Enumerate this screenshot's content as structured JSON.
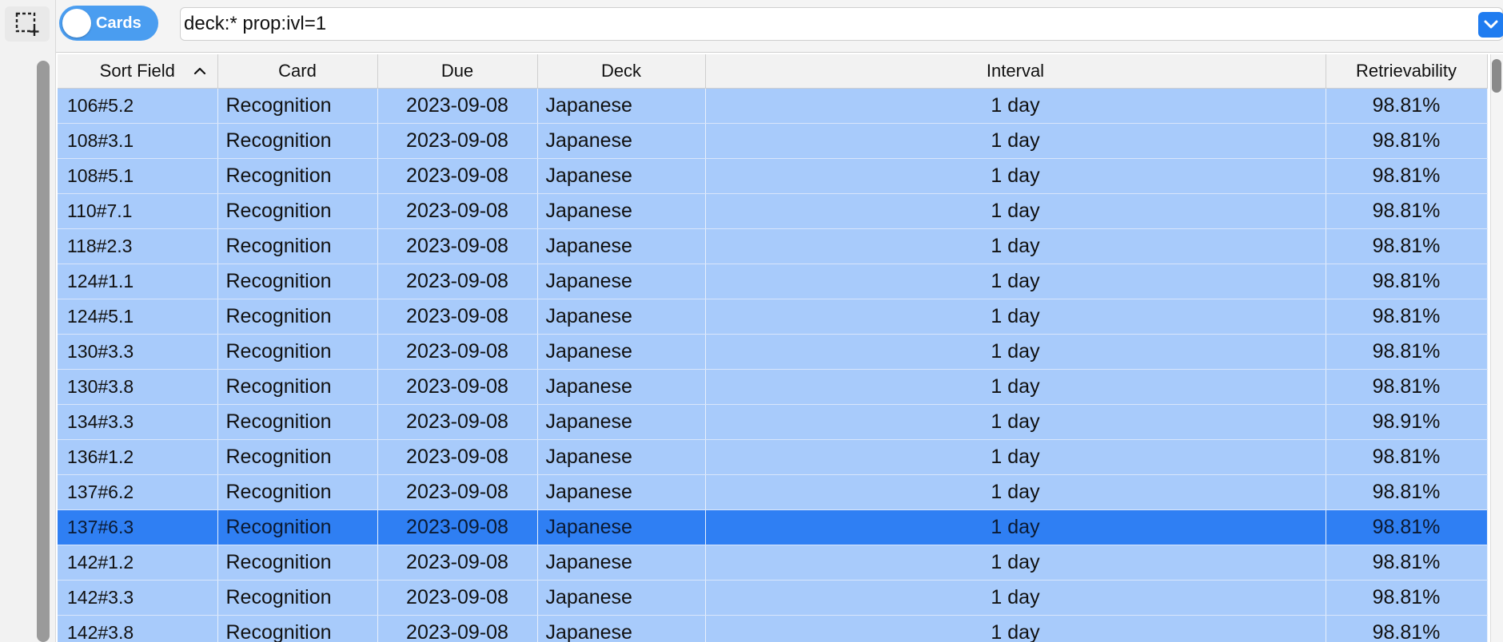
{
  "toggle": {
    "label": "Cards",
    "accent": "#4a9df0"
  },
  "search": {
    "value": "deck:* prop:ivl=1"
  },
  "icons": {
    "select": "select-marquee-plus-icon",
    "dropdown": "chevron-down-icon",
    "sort": "chevron-up-icon"
  },
  "table": {
    "headers": {
      "sort_field": "Sort Field",
      "card": "Card",
      "due": "Due",
      "deck": "Deck",
      "interval": "Interval",
      "retrievability": "Retrievability"
    },
    "rows": [
      {
        "sort": "106#5.2",
        "card": "Recognition",
        "due": "2023-09-08",
        "deck": "Japanese",
        "interval": "1 day",
        "ret": "98.81%"
      },
      {
        "sort": "108#3.1",
        "card": "Recognition",
        "due": "2023-09-08",
        "deck": "Japanese",
        "interval": "1 day",
        "ret": "98.81%"
      },
      {
        "sort": "108#5.1",
        "card": "Recognition",
        "due": "2023-09-08",
        "deck": "Japanese",
        "interval": "1 day",
        "ret": "98.81%"
      },
      {
        "sort": "110#7.1",
        "card": "Recognition",
        "due": "2023-09-08",
        "deck": "Japanese",
        "interval": "1 day",
        "ret": "98.81%"
      },
      {
        "sort": "118#2.3",
        "card": "Recognition",
        "due": "2023-09-08",
        "deck": "Japanese",
        "interval": "1 day",
        "ret": "98.81%"
      },
      {
        "sort": "124#1.1",
        "card": "Recognition",
        "due": "2023-09-08",
        "deck": "Japanese",
        "interval": "1 day",
        "ret": "98.81%"
      },
      {
        "sort": "124#5.1",
        "card": "Recognition",
        "due": "2023-09-08",
        "deck": "Japanese",
        "interval": "1 day",
        "ret": "98.81%"
      },
      {
        "sort": "130#3.3",
        "card": "Recognition",
        "due": "2023-09-08",
        "deck": "Japanese",
        "interval": "1 day",
        "ret": "98.81%"
      },
      {
        "sort": "130#3.8",
        "card": "Recognition",
        "due": "2023-09-08",
        "deck": "Japanese",
        "interval": "1 day",
        "ret": "98.81%"
      },
      {
        "sort": "134#3.3",
        "card": "Recognition",
        "due": "2023-09-08",
        "deck": "Japanese",
        "interval": "1 day",
        "ret": "98.91%"
      },
      {
        "sort": "136#1.2",
        "card": "Recognition",
        "due": "2023-09-08",
        "deck": "Japanese",
        "interval": "1 day",
        "ret": "98.81%"
      },
      {
        "sort": "137#6.2",
        "card": "Recognition",
        "due": "2023-09-08",
        "deck": "Japanese",
        "interval": "1 day",
        "ret": "98.81%"
      },
      {
        "sort": "137#6.3",
        "card": "Recognition",
        "due": "2023-09-08",
        "deck": "Japanese",
        "interval": "1 day",
        "ret": "98.81%",
        "selected": true
      },
      {
        "sort": "142#1.2",
        "card": "Recognition",
        "due": "2023-09-08",
        "deck": "Japanese",
        "interval": "1 day",
        "ret": "98.81%"
      },
      {
        "sort": "142#3.3",
        "card": "Recognition",
        "due": "2023-09-08",
        "deck": "Japanese",
        "interval": "1 day",
        "ret": "98.81%"
      },
      {
        "sort": "142#3.8",
        "card": "Recognition",
        "due": "2023-09-08",
        "deck": "Japanese",
        "interval": "1 day",
        "ret": "98.81%"
      }
    ]
  },
  "colors": {
    "row": "#a8cbfb",
    "selected_row": "#2f7ff3",
    "header": "#f2f2f2"
  }
}
